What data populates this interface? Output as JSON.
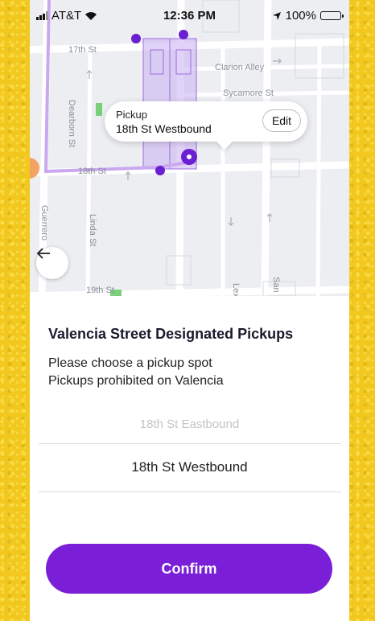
{
  "status_bar": {
    "carrier": "AT&T",
    "time": "12:36 PM",
    "battery": "100%"
  },
  "map": {
    "streets": {
      "st_17": "17th St",
      "clarion": "Clarion Alley",
      "sycamore": "Sycamore St",
      "dearborn": "Dearborn St",
      "st_18": "18th St",
      "guerrero": "Guerrero",
      "linda": "Linda St",
      "st_19": "19th St",
      "lex": "Lex",
      "san": "San"
    },
    "route_color": "#c9a8f0",
    "accent_color": "#6a1fd1",
    "callout": {
      "label": "Pickup",
      "location": "18th St Westbound",
      "edit_label": "Edit"
    }
  },
  "sheet": {
    "title": "Valencia Street Designated Pickups",
    "line1": "Please choose a pickup spot",
    "line2": "Pickups prohibited on Valencia",
    "picker_options": [
      "18th St Eastbound",
      "18th St Westbound"
    ],
    "picker_selected": "18th St Westbound",
    "confirm_label": "Confirm"
  },
  "colors": {
    "confirm_bg": "#7a1ed8",
    "background": "#f2c81f"
  }
}
